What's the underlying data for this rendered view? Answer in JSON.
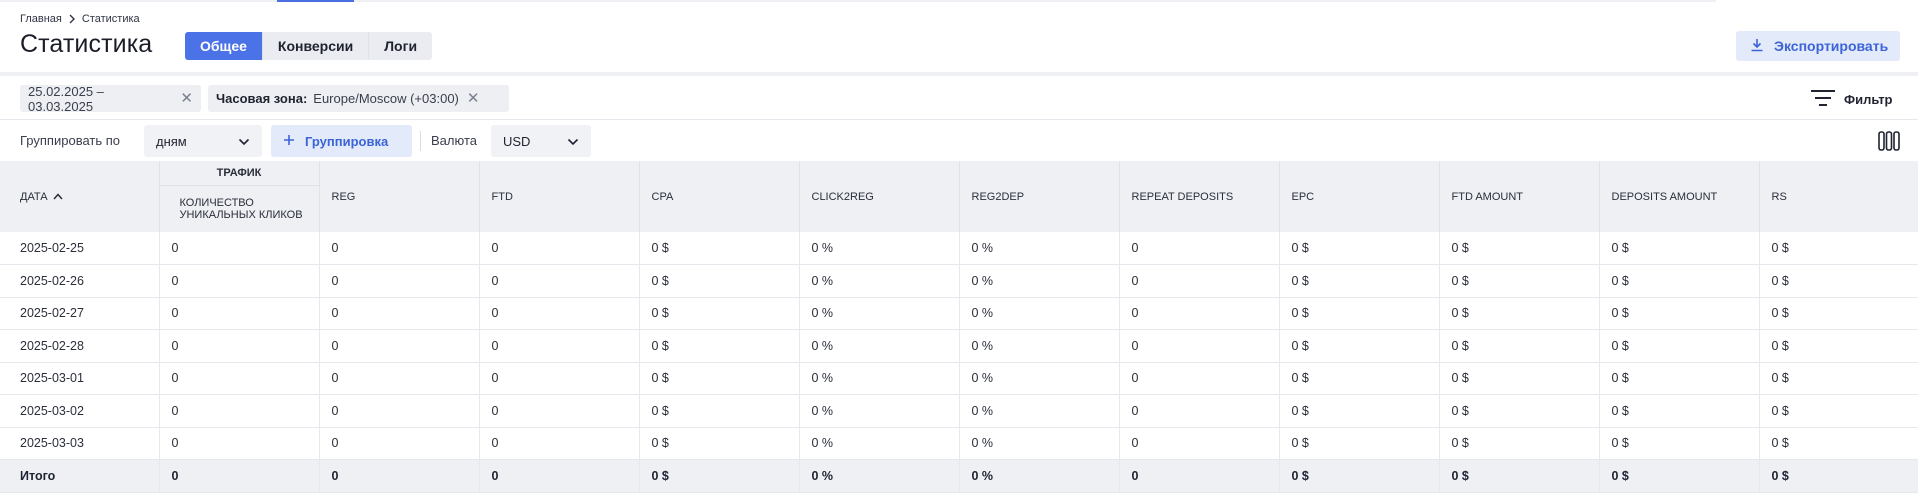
{
  "breadcrumb": {
    "home": "Главная",
    "current": "Статистика"
  },
  "page_title": "Статистика",
  "tabs": [
    {
      "label": "Общее",
      "active": true
    },
    {
      "label": "Конверсии",
      "active": false
    },
    {
      "label": "Логи",
      "active": false
    }
  ],
  "export_label": "Экспортировать",
  "filters": {
    "date_range": "25.02.2025 – 03.03.2025",
    "timezone_label": "Часовая зона:",
    "timezone_value": "Europe/Moscow (+03:00)",
    "filter_label": "Фильтр"
  },
  "controls": {
    "group_by_label": "Группировать по",
    "group_by_value": "дням",
    "group_button": "Группировка",
    "currency_label": "Валюта",
    "currency_value": "USD"
  },
  "table": {
    "group_header": "Трафик",
    "columns": [
      "Дата",
      "Количество уникальных кликов",
      "REG",
      "FTD",
      "CPA",
      "CLICK2REG",
      "REG2DEP",
      "REPEAT DEPOSITS",
      "EPC",
      "FTD AMOUNT",
      "DEPOSITS AMOUNT",
      "RS"
    ],
    "rows": [
      [
        "2025-02-25",
        "0",
        "0",
        "0",
        "0 $",
        "0 %",
        "0 %",
        "0",
        "0 $",
        "0 $",
        "0 $",
        "0 $"
      ],
      [
        "2025-02-26",
        "0",
        "0",
        "0",
        "0 $",
        "0 %",
        "0 %",
        "0",
        "0 $",
        "0 $",
        "0 $",
        "0 $"
      ],
      [
        "2025-02-27",
        "0",
        "0",
        "0",
        "0 $",
        "0 %",
        "0 %",
        "0",
        "0 $",
        "0 $",
        "0 $",
        "0 $"
      ],
      [
        "2025-02-28",
        "0",
        "0",
        "0",
        "0 $",
        "0 %",
        "0 %",
        "0",
        "0 $",
        "0 $",
        "0 $",
        "0 $"
      ],
      [
        "2025-03-01",
        "0",
        "0",
        "0",
        "0 $",
        "0 %",
        "0 %",
        "0",
        "0 $",
        "0 $",
        "0 $",
        "0 $"
      ],
      [
        "2025-03-02",
        "0",
        "0",
        "0",
        "0 $",
        "0 %",
        "0 %",
        "0",
        "0 $",
        "0 $",
        "0 $",
        "0 $"
      ],
      [
        "2025-03-03",
        "0",
        "0",
        "0",
        "0 $",
        "0 %",
        "0 %",
        "0",
        "0 $",
        "0 $",
        "0 $",
        "0 $"
      ]
    ],
    "total": [
      "Итого",
      "0",
      "0",
      "0",
      "0 $",
      "0 %",
      "0 %",
      "0",
      "0 $",
      "0 $",
      "0 $",
      "0 $"
    ]
  },
  "colors": {
    "accent": "#4b72e6",
    "accent_light": "#e3eaf9",
    "header_bg": "#eef0f4"
  }
}
